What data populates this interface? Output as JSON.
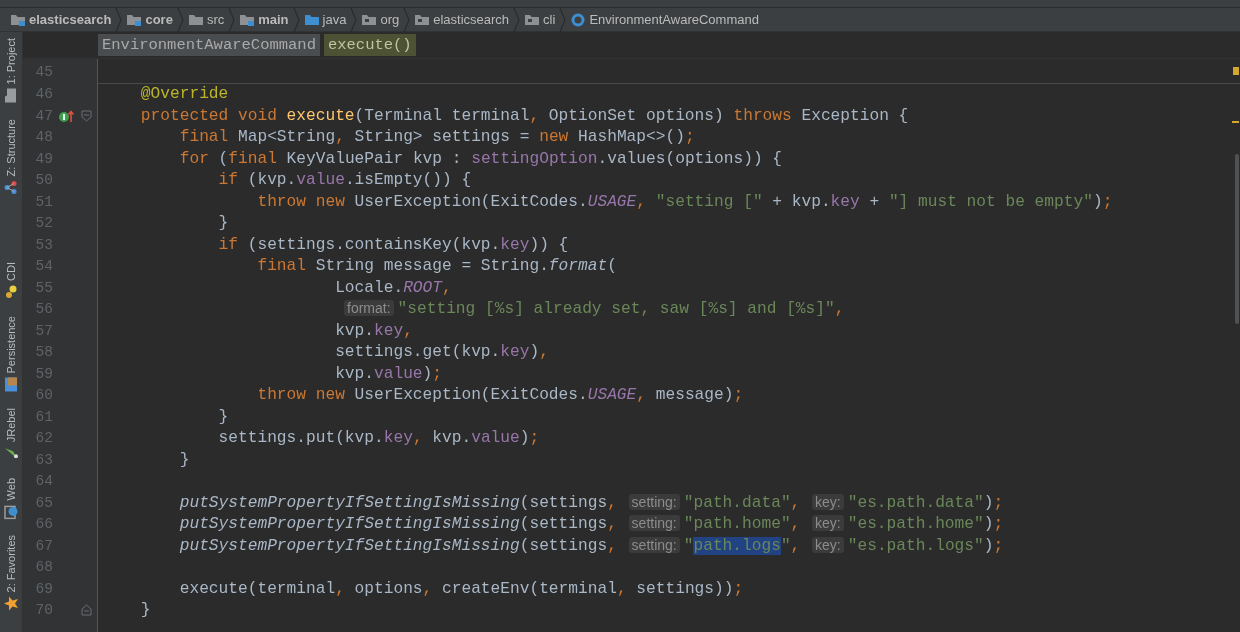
{
  "breadcrumbs": [
    {
      "label": "elasticsearch",
      "kind": "module",
      "bold": true
    },
    {
      "label": "core",
      "kind": "module",
      "bold": true
    },
    {
      "label": "src",
      "kind": "folder",
      "bold": false
    },
    {
      "label": "main",
      "kind": "module",
      "bold": true
    },
    {
      "label": "java",
      "kind": "source",
      "bold": false
    },
    {
      "label": "org",
      "kind": "package",
      "bold": false
    },
    {
      "label": "elasticsearch",
      "kind": "package",
      "bold": false
    },
    {
      "label": "cli",
      "kind": "package",
      "bold": false
    },
    {
      "label": "EnvironmentAwareCommand",
      "kind": "class",
      "bold": false
    }
  ],
  "editor_breadcrumbs": [
    {
      "label": "EnvironmentAwareCommand",
      "selected": false
    },
    {
      "label": "execute()",
      "selected": true
    }
  ],
  "tool_windows": [
    {
      "label": "1: Project",
      "kind": "project"
    },
    {
      "label": "Z: Structure",
      "kind": "structure"
    },
    {
      "label": "CDI",
      "kind": "cdi"
    },
    {
      "label": "Persistence",
      "kind": "persistence"
    },
    {
      "label": "JRebel",
      "kind": "jrebel"
    },
    {
      "label": "Web",
      "kind": "web"
    },
    {
      "label": "2: Favorites",
      "kind": "favorites"
    }
  ],
  "lines": [
    {
      "number": "45",
      "method_separator": true
    },
    {
      "number": "46",
      "tokens": [
        {
          "kind": "annotation",
          "text": "    @Override"
        }
      ]
    },
    {
      "number": "47",
      "override_marker": true,
      "fold_start": true,
      "tokens": [
        {
          "kind": "keyword",
          "text": "    protected void "
        },
        {
          "kind": "declaration",
          "text": "execute"
        },
        {
          "kind": "plain",
          "text": "(Terminal terminal"
        },
        {
          "kind": "keyword",
          "text": ","
        },
        {
          "kind": "plain",
          "text": " OptionSet options) "
        },
        {
          "kind": "keyword",
          "text": "throws "
        },
        {
          "kind": "plain",
          "text": "Exception {"
        }
      ]
    },
    {
      "number": "48",
      "tokens": [
        {
          "kind": "keyword",
          "text": "        final "
        },
        {
          "kind": "plain",
          "text": "Map<String"
        },
        {
          "kind": "keyword",
          "text": ","
        },
        {
          "kind": "plain",
          "text": " String> settings = "
        },
        {
          "kind": "keyword",
          "text": "new "
        },
        {
          "kind": "plain",
          "text": "HashMap<>()"
        },
        {
          "kind": "keyword",
          "text": ";"
        }
      ]
    },
    {
      "number": "49",
      "tokens": [
        {
          "kind": "keyword",
          "text": "        for "
        },
        {
          "kind": "plain",
          "text": "("
        },
        {
          "kind": "keyword",
          "text": "final "
        },
        {
          "kind": "plain",
          "text": "KeyValuePair kvp : "
        },
        {
          "kind": "field",
          "text": "settingOption"
        },
        {
          "kind": "plain",
          "text": ".values(options)) {"
        }
      ]
    },
    {
      "number": "50",
      "tokens": [
        {
          "kind": "keyword",
          "text": "            if "
        },
        {
          "kind": "plain",
          "text": "(kvp."
        },
        {
          "kind": "field",
          "text": "value"
        },
        {
          "kind": "plain",
          "text": ".isEmpty()) {"
        }
      ]
    },
    {
      "number": "51",
      "tokens": [
        {
          "kind": "keyword",
          "text": "                throw new "
        },
        {
          "kind": "plain",
          "text": "UserException(ExitCodes."
        },
        {
          "kind": "constant",
          "text": "USAGE"
        },
        {
          "kind": "keyword",
          "text": ", "
        },
        {
          "kind": "string",
          "text": "\"setting [\""
        },
        {
          "kind": "plain",
          "text": " + kvp."
        },
        {
          "kind": "field",
          "text": "key"
        },
        {
          "kind": "plain",
          "text": " + "
        },
        {
          "kind": "string",
          "text": "\"] must not be empty\""
        },
        {
          "kind": "plain",
          "text": ")"
        },
        {
          "kind": "keyword",
          "text": ";"
        }
      ]
    },
    {
      "number": "52",
      "tokens": [
        {
          "kind": "plain",
          "text": "            }"
        }
      ]
    },
    {
      "number": "53",
      "tokens": [
        {
          "kind": "keyword",
          "text": "            if "
        },
        {
          "kind": "plain",
          "text": "(settings.containsKey(kvp."
        },
        {
          "kind": "field",
          "text": "key"
        },
        {
          "kind": "plain",
          "text": ")) {"
        }
      ]
    },
    {
      "number": "54",
      "tokens": [
        {
          "kind": "keyword",
          "text": "                final "
        },
        {
          "kind": "plain",
          "text": "String message = String."
        },
        {
          "kind": "italic",
          "text": "format"
        },
        {
          "kind": "plain",
          "text": "("
        }
      ]
    },
    {
      "number": "55",
      "tokens": [
        {
          "kind": "plain",
          "text": "                        Locale."
        },
        {
          "kind": "constant",
          "text": "ROOT"
        },
        {
          "kind": "keyword",
          "text": ","
        }
      ]
    },
    {
      "number": "56",
      "tokens": [
        {
          "kind": "hint",
          "text": "format:"
        },
        {
          "kind": "string",
          "text": "\"setting [%s] already set, saw [%s] and [%s]\""
        },
        {
          "kind": "keyword",
          "text": ","
        }
      ]
    },
    {
      "number": "57",
      "tokens": [
        {
          "kind": "plain",
          "text": "                        kvp."
        },
        {
          "kind": "field",
          "text": "key"
        },
        {
          "kind": "keyword",
          "text": ","
        }
      ]
    },
    {
      "number": "58",
      "tokens": [
        {
          "kind": "plain",
          "text": "                        settings.get(kvp."
        },
        {
          "kind": "field",
          "text": "key"
        },
        {
          "kind": "plain",
          "text": ")"
        },
        {
          "kind": "keyword",
          "text": ","
        }
      ]
    },
    {
      "number": "59",
      "tokens": [
        {
          "kind": "plain",
          "text": "                        kvp."
        },
        {
          "kind": "field",
          "text": "value"
        },
        {
          "kind": "plain",
          "text": ")"
        },
        {
          "kind": "keyword",
          "text": ";"
        }
      ]
    },
    {
      "number": "60",
      "tokens": [
        {
          "kind": "keyword",
          "text": "                throw new "
        },
        {
          "kind": "plain",
          "text": "UserException(ExitCodes."
        },
        {
          "kind": "constant",
          "text": "USAGE"
        },
        {
          "kind": "keyword",
          "text": ", "
        },
        {
          "kind": "plain",
          "text": "message)"
        },
        {
          "kind": "keyword",
          "text": ";"
        }
      ]
    },
    {
      "number": "61",
      "tokens": [
        {
          "kind": "plain",
          "text": "            }"
        }
      ]
    },
    {
      "number": "62",
      "tokens": [
        {
          "kind": "plain",
          "text": "            settings.put(kvp."
        },
        {
          "kind": "field",
          "text": "key"
        },
        {
          "kind": "keyword",
          "text": ", "
        },
        {
          "kind": "plain",
          "text": "kvp."
        },
        {
          "kind": "field",
          "text": "value"
        },
        {
          "kind": "plain",
          "text": ")"
        },
        {
          "kind": "keyword",
          "text": ";"
        }
      ]
    },
    {
      "number": "63",
      "tokens": [
        {
          "kind": "plain",
          "text": "        }"
        }
      ]
    },
    {
      "number": "64"
    },
    {
      "number": "65",
      "tokens": [
        {
          "kind": "italic",
          "text": "        putSystemPropertyIfSettingIsMissing"
        },
        {
          "kind": "plain",
          "text": "(settings"
        },
        {
          "kind": "keyword",
          "text": ", "
        },
        {
          "kind": "hint",
          "text": "setting:"
        },
        {
          "kind": "string",
          "text": "\"path.data\""
        },
        {
          "kind": "keyword",
          "text": ", "
        },
        {
          "kind": "hint",
          "text": "key:"
        },
        {
          "kind": "string",
          "text": "\"es.path.data\""
        },
        {
          "kind": "plain",
          "text": ")"
        },
        {
          "kind": "keyword",
          "text": ";"
        }
      ]
    },
    {
      "number": "66",
      "tokens": [
        {
          "kind": "italic",
          "text": "        putSystemPropertyIfSettingIsMissing"
        },
        {
          "kind": "plain",
          "text": "(settings"
        },
        {
          "kind": "keyword",
          "text": ", "
        },
        {
          "kind": "hint",
          "text": "setting:"
        },
        {
          "kind": "string",
          "text": "\"path.home\""
        },
        {
          "kind": "keyword",
          "text": ", "
        },
        {
          "kind": "hint",
          "text": "key:"
        },
        {
          "kind": "string",
          "text": "\"es.path.home\""
        },
        {
          "kind": "plain",
          "text": ")"
        },
        {
          "kind": "keyword",
          "text": ";"
        }
      ]
    },
    {
      "number": "67",
      "tokens": [
        {
          "kind": "italic",
          "text": "        putSystemPropertyIfSettingIsMissing"
        },
        {
          "kind": "plain",
          "text": "(settings"
        },
        {
          "kind": "keyword",
          "text": ", "
        },
        {
          "kind": "hint",
          "text": "setting:"
        },
        {
          "kind": "string",
          "text": "\""
        },
        {
          "kind": "selected_string",
          "text": "path.logs"
        },
        {
          "kind": "string",
          "text": "\""
        },
        {
          "kind": "keyword",
          "text": ", "
        },
        {
          "kind": "hint",
          "text": "key:"
        },
        {
          "kind": "string",
          "text": "\"es.path.logs\""
        },
        {
          "kind": "plain",
          "text": ")"
        },
        {
          "kind": "keyword",
          "text": ";"
        }
      ]
    },
    {
      "number": "68"
    },
    {
      "number": "69",
      "tokens": [
        {
          "kind": "plain",
          "text": "        execute(terminal"
        },
        {
          "kind": "keyword",
          "text": ", "
        },
        {
          "kind": "plain",
          "text": "options"
        },
        {
          "kind": "keyword",
          "text": ", "
        },
        {
          "kind": "plain",
          "text": "createEnv(terminal"
        },
        {
          "kind": "keyword",
          "text": ", "
        },
        {
          "kind": "plain",
          "text": "settings))"
        },
        {
          "kind": "keyword",
          "text": ";"
        }
      ]
    },
    {
      "number": "70",
      "fold_end": true,
      "tokens": [
        {
          "kind": "plain",
          "text": "    }"
        }
      ]
    }
  ]
}
